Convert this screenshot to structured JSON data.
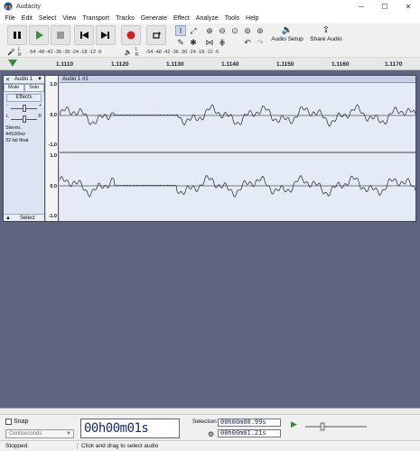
{
  "window": {
    "title": "Audacity"
  },
  "menu": [
    "File",
    "Edit",
    "Select",
    "View",
    "Transport",
    "Tracks",
    "Generate",
    "Effect",
    "Analyze",
    "Tools",
    "Help"
  ],
  "toolbar": {
    "audio_setup_label": "Audio Setup",
    "share_audio_label": "Share Audio"
  },
  "meter": {
    "record_scale": "-54 -48 -42 -36 -30 -24 -18 -12 -6",
    "playback_scale": "-54 -48 -42 -36 -30 -24 -18 -12 -6",
    "record_lr": "L R",
    "playback_lr": "L R"
  },
  "ruler": {
    "ticks": [
      "1.1110",
      "1.1120",
      "1.1130",
      "1.1140",
      "1.1150",
      "1.1160",
      "1.1170"
    ]
  },
  "track": {
    "name": "Audio 1",
    "clip_name": "Audio 1 #1",
    "mute_label": "Mute",
    "solo_label": "Solo",
    "effects_label": "Effects",
    "gain_minus": "-",
    "gain_plus": "+",
    "pan_left": "L",
    "pan_right": "R",
    "info_line1": "Stereo, 44100Hz",
    "info_line2": "32-bit float",
    "select_label": "Select",
    "scale": {
      "top": "1.0",
      "mid": "0.0",
      "bottom": "-1.0"
    }
  },
  "selection_toolbar": {
    "snap_label": "Snap",
    "snap_unit": "Centiseconds",
    "time_display": "00h00m01s",
    "selection_label": "Selection",
    "sel_start": "00h00m00.99s",
    "sel_end": "00h00m01.21s"
  },
  "status": {
    "state": "Stopped.",
    "hint": "Click and drag to select audio"
  },
  "colors": {
    "background": "#5f6480",
    "waveform": "#3a3a3a",
    "track_bg": "#e4ebf7",
    "play_green": "#3a8f3a",
    "record_red": "#cc2222"
  }
}
